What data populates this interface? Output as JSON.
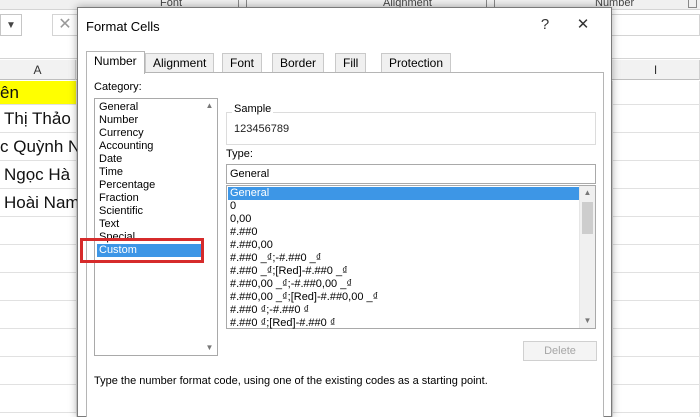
{
  "ribbon": {
    "groups": [
      "Font",
      "Alignment",
      "Number"
    ]
  },
  "sheet": {
    "column_headers": [
      "A",
      "I"
    ],
    "cells": [
      "ên",
      "Thị Thảo",
      "c Quỳnh N",
      "Ngọc Hà",
      "Hoài Nam"
    ],
    "highlight_color": "#ffff00"
  },
  "dialog": {
    "title": "Format Cells",
    "help_glyph": "?",
    "close_glyph": "✕",
    "tabs": [
      "Number",
      "Alignment",
      "Font",
      "Border",
      "Fill",
      "Protection"
    ],
    "active_tab": "Number",
    "category_label": "Category:",
    "categories": [
      "General",
      "Number",
      "Currency",
      "Accounting",
      "Date",
      "Time",
      "Percentage",
      "Fraction",
      "Scientific",
      "Text",
      "Special",
      "Custom"
    ],
    "selected_category": "Custom",
    "sample_label": "Sample",
    "sample_value": "123456789",
    "type_label": "Type:",
    "type_value": "General",
    "formats": [
      "General",
      "0",
      "0,00",
      "#.##0",
      "#.##0,00",
      "#.##0 _₫;-#.##0 _₫",
      "#.##0 _₫;[Red]-#.##0 _₫",
      "#.##0,00 _₫;-#.##0,00 _₫",
      "#.##0,00 _₫;[Red]-#.##0,00 _₫",
      "#.##0 ₫;-#.##0 ₫",
      "#.##0 ₫;[Red]-#.##0 ₫"
    ],
    "selected_format": "General",
    "delete_label": "Delete",
    "hint": "Type the number format code, using one of the existing codes as a starting point.",
    "accent_color": "#3d96e6",
    "callout_color": "#d62b2b"
  }
}
